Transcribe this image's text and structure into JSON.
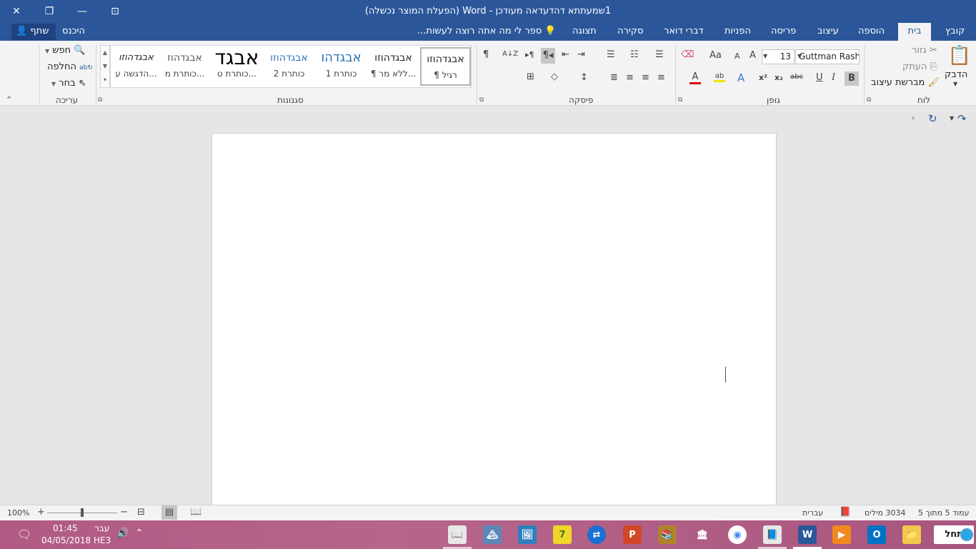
{
  "window": {
    "title": "1שמעתתא  דהדעדאה מעודכן - Word (הפעלת המוצר נכשלה)",
    "close_glyph": "✕",
    "restore_glyph": "❐",
    "minimize_glyph": "—",
    "ribbon_toggle_glyph": "⊡"
  },
  "tabs": [
    {
      "label": "קובץ"
    },
    {
      "label": "בית"
    },
    {
      "label": "הוספה"
    },
    {
      "label": "עיצוב"
    },
    {
      "label": "פריסה"
    },
    {
      "label": "הפניות"
    },
    {
      "label": "דברי דואר"
    },
    {
      "label": "סקירה"
    },
    {
      "label": "תצוגה"
    }
  ],
  "tell_me": "ספר לי מה אתה רוצה לעשות...",
  "share_label": "שתף",
  "signin_label": "היכנס",
  "ribbon": {
    "clipboard": {
      "group": "לוח",
      "paste": "הדבק",
      "cut": "גזור",
      "copy": "העתק",
      "format_painter": "מברשת עיצוב"
    },
    "font": {
      "group": "גופן",
      "name": "Guttman Rashi",
      "size": "13",
      "grow": "A",
      "shrink": "A",
      "change_case": "Aa",
      "bold": "B",
      "italic": "I",
      "underline": "U",
      "strike": "abc",
      "subscript": "x₂",
      "superscript": "x²",
      "effects": "A",
      "highlight": "ab",
      "font_color": "A"
    },
    "paragraph": {
      "group": "פיסקה",
      "show_marks": "¶",
      "sort": "A↓Z",
      "rtl": "¶◂",
      "ltr": "▸¶"
    },
    "styles": {
      "group": "סגנונות",
      "items": [
        {
          "preview": "אבגדהוזו",
          "name": "¶ רגיל"
        },
        {
          "preview": "אבגדהוזו",
          "name": "¶ ללא מר..."
        },
        {
          "preview": "אבגדהו",
          "name": "כותרת 1"
        },
        {
          "preview": "אבגדהוזו",
          "name": "כותרת 2"
        },
        {
          "preview": "אבגד",
          "name": "כותרת ט..."
        },
        {
          "preview": "אבגדהוז",
          "name": "כותרת מ..."
        },
        {
          "preview": "אבגדהוזו",
          "name": "הדגשה ע..."
        }
      ]
    },
    "editing": {
      "group": "עריכה",
      "find": "חפש",
      "replace": "החלפה",
      "select": "בחר"
    }
  },
  "status": {
    "page": "עמוד 5 מתוך 5",
    "words": "3034 מילים",
    "language": "עברית",
    "zoom": "100%"
  },
  "taskbar": {
    "start": "התחל",
    "time": "01:45",
    "date": "04/05/2018",
    "lang_top": "עבר",
    "lang_bottom": "HE3"
  },
  "colors": {
    "word_blue": "#2b579a",
    "ribbon_bg": "#f3f3f3",
    "taskbar": "#b05a84"
  }
}
